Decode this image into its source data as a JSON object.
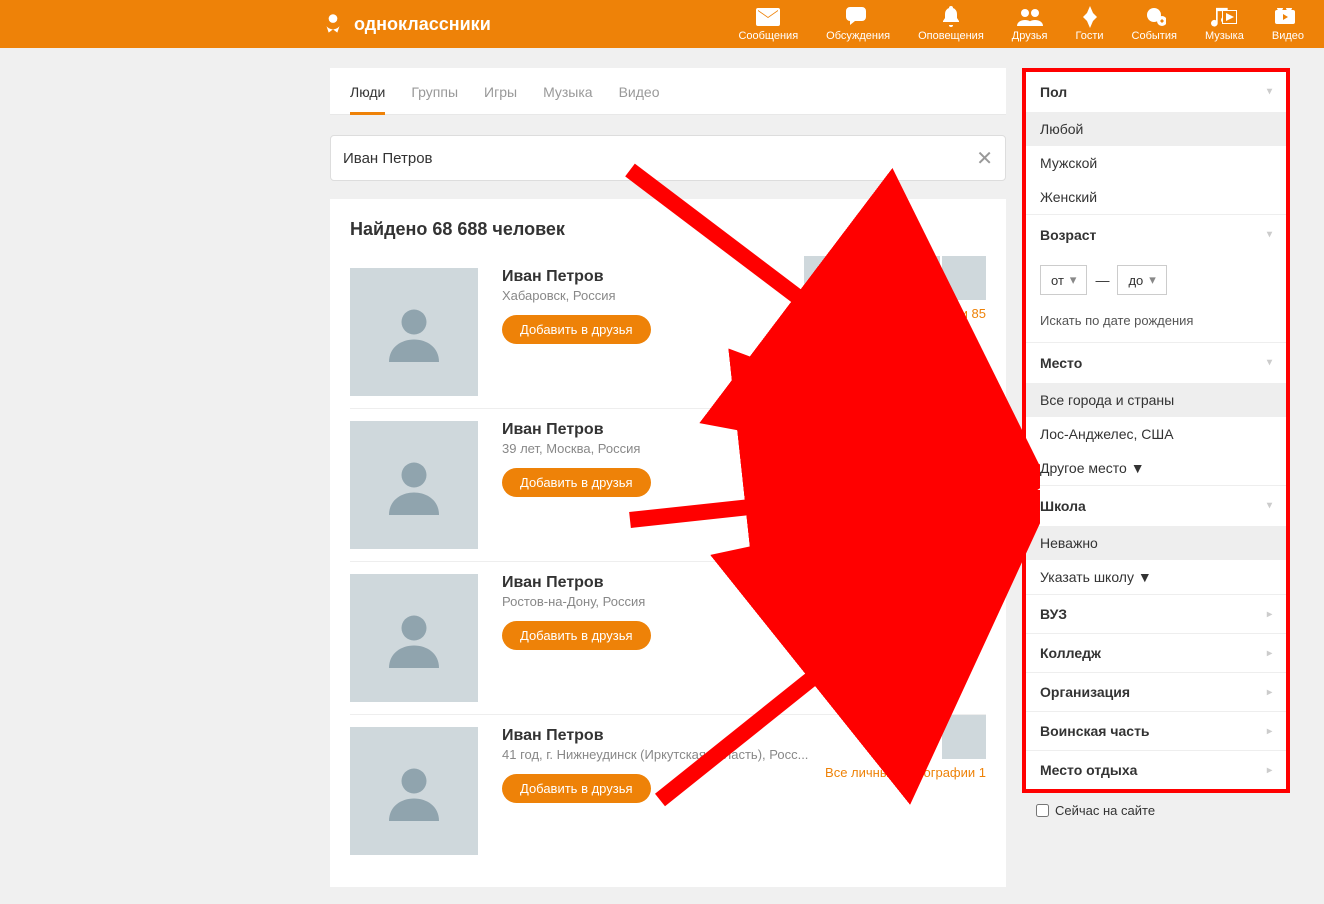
{
  "header": {
    "brand": "одноклассники",
    "nav": [
      {
        "label": "Сообщения",
        "icon": "envelope"
      },
      {
        "label": "Обсуждения",
        "icon": "chat"
      },
      {
        "label": "Оповещения",
        "icon": "bell"
      },
      {
        "label": "Друзья",
        "icon": "friends"
      },
      {
        "label": "Гости",
        "icon": "guests"
      },
      {
        "label": "События",
        "icon": "events"
      },
      {
        "label": "Музыка",
        "icon": "music"
      },
      {
        "label": "Видео",
        "icon": "video"
      }
    ]
  },
  "tabs": [
    {
      "label": "Люди",
      "active": true
    },
    {
      "label": "Группы"
    },
    {
      "label": "Игры"
    },
    {
      "label": "Музыка"
    },
    {
      "label": "Видео"
    }
  ],
  "search": {
    "value": "Иван Петров"
  },
  "results": {
    "count_label": "Найдено 68 688 человек",
    "items": [
      {
        "name": "Иван Петров",
        "loc": "Хабаровск, Россия",
        "add": "Добавить в друзья",
        "photos_link": "Все личные фотографии 85",
        "thumbs": 4
      },
      {
        "name": "Иван Петров",
        "loc": "39 лет, Москва, Россия",
        "add": "Добавить в друзья"
      },
      {
        "name": "Иван Петров",
        "loc": "Ростов-на-Дону, Россия",
        "add": "Добавить в друзья"
      },
      {
        "name": "Иван Петров",
        "loc": "41 год, г. Нижнеудинск (Иркутская область), Росс...",
        "add": "Добавить в друзья",
        "photos_link": "Все личные фотографии 1",
        "thumbs": 1
      }
    ]
  },
  "filters": {
    "gender": {
      "title": "Пол",
      "opts": [
        "Любой",
        "Мужской",
        "Женский"
      ],
      "selected": "Любой"
    },
    "age": {
      "title": "Возраст",
      "from": "от",
      "to": "до",
      "dash": "—",
      "search_link": "Искать по дате рождения"
    },
    "place": {
      "title": "Место",
      "opts": [
        "Все города и страны",
        "Лос-Анджелес, США"
      ],
      "more": "Другое место ▼",
      "selected": "Все города и страны"
    },
    "school": {
      "title": "Школа",
      "opts": [
        "Неважно"
      ],
      "more": "Указать школу ▼",
      "selected": "Неважно"
    },
    "simple": [
      "ВУЗ",
      "Колледж",
      "Организация",
      "Воинская часть",
      "Место отдыха"
    ],
    "online": "Сейчас на сайте"
  }
}
